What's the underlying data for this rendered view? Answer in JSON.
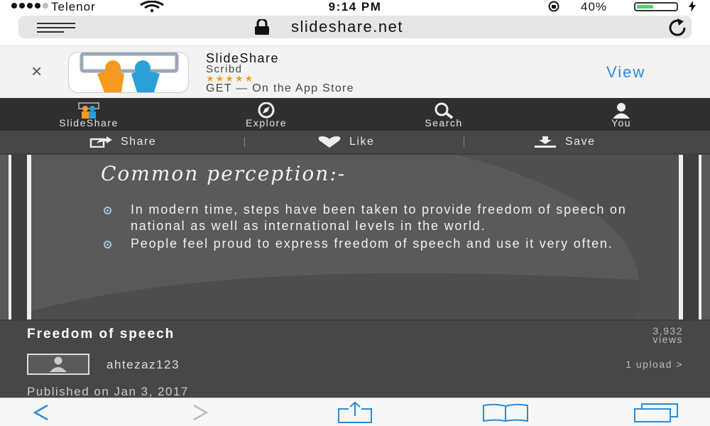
{
  "status": {
    "carrier": "Telenor",
    "time": "9:14 PM",
    "battery_pct": "40%",
    "battery_level": 0.4
  },
  "browser": {
    "domain": "slideshare.net",
    "icons": [
      "menu-lines-icon",
      "padlock-icon",
      "reload-icon"
    ]
  },
  "app_banner": {
    "close": "×",
    "app_name": "SlideShare",
    "developer": "Scribd",
    "stars": "★★★★★",
    "rating": 4.5,
    "get_text": "GET — On the App Store",
    "view_label": "View"
  },
  "nav": {
    "items": [
      {
        "label": "SlideShare",
        "icon": "slideshare-logo-icon"
      },
      {
        "label": "Explore",
        "icon": "compass-icon"
      },
      {
        "label": "Search",
        "icon": "search-icon"
      },
      {
        "label": "You",
        "icon": "user-icon"
      }
    ]
  },
  "actions": {
    "share": "Share",
    "like": "Like",
    "save": "Save"
  },
  "slide": {
    "title": "Common perception:-",
    "bullets": [
      "In modern time, steps have been taken to provide freedom of speech on national as well as international levels in the world.",
      "People feel proud to express freedom of speech and use it very often."
    ]
  },
  "info": {
    "title": "Freedom of speech",
    "views_count": "3,932",
    "views_label": "views",
    "username": "ahtezaz123",
    "uploads": "1 upload",
    "uploads_chevron": ">",
    "published": "Published on Jan 3, 2017"
  },
  "toolbar": {
    "back": "<",
    "forward": ">",
    "icons": [
      "back-icon",
      "forward-icon",
      "share-icon",
      "bookmarks-icon",
      "tabs-icon"
    ]
  },
  "colors": {
    "accent": "#2a8ad8",
    "nav_bg": "#2f2f2f",
    "content_bg": "#474747",
    "star": "#f0a020",
    "battery": "#4cd964"
  }
}
